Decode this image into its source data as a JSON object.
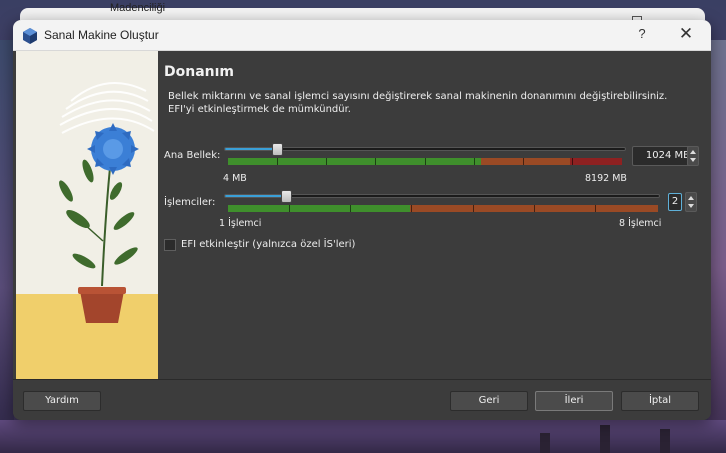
{
  "background": {
    "window_title": "Madenciliği"
  },
  "dialog": {
    "title": "Sanal Makine Oluştur",
    "help_label": "?",
    "close_label": "✕"
  },
  "page": {
    "heading": "Donanım",
    "description_line1": "Bellek miktarını ve sanal işlemci sayısını değiştirerek sanal makinenin donanımını değiştirebilirsiniz.",
    "description_line2": "EFI'yi etkinleştirmek de mümkündür."
  },
  "memory": {
    "label": "Ana Bellek:",
    "value": "1024 MB",
    "value_mb": 1024,
    "min_label": "4 MB",
    "max_label": "8192 MB",
    "fraction": 0.125
  },
  "cpu": {
    "label": "İşlemciler:",
    "value": "2",
    "min_label": "1 İşlemci",
    "max_label": "8 İşlemci",
    "fraction": 0.143
  },
  "efi": {
    "label": "EFI etkinleştir (yalnızca özel İS'leri)",
    "checked": false
  },
  "buttons": {
    "help": "Yardım",
    "back": "Geri",
    "next": "İleri",
    "cancel": "İptal"
  },
  "colors": {
    "accent": "#3aa0d8",
    "scale_green": "#3f8f2c",
    "scale_orange": "#9a4a25",
    "scale_red": "#8e2121",
    "dialog_bg": "#3c3c3c"
  }
}
